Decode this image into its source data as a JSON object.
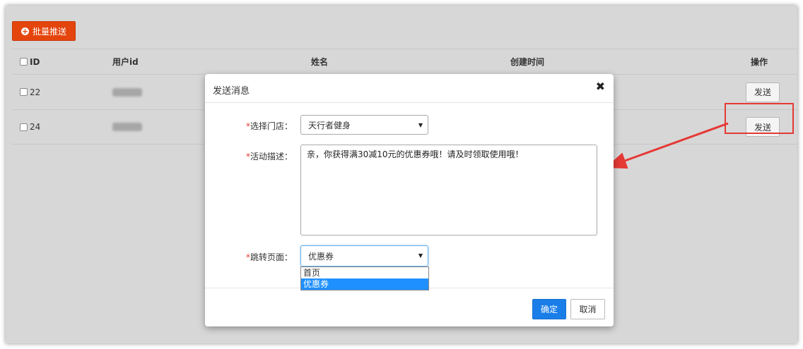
{
  "toolbar": {
    "batch_push_label": "批量推送",
    "batch_push_icon": "plus-circle-icon"
  },
  "table": {
    "headers": {
      "id": "ID",
      "user_id": "用户id",
      "name": "姓名",
      "created": "创建时间",
      "ops": "操作"
    },
    "rows": [
      {
        "id": "22",
        "send_label": "发送"
      },
      {
        "id": "24",
        "send_label": "发送"
      }
    ]
  },
  "modal": {
    "title": "发送消息",
    "close_icon": "close-icon",
    "store_label": "选择门店：",
    "store_value": "天行者健身",
    "desc_label": "活动描述：",
    "desc_value": "亲，你获得满30减10元的优惠券哦！请及时领取使用哦！",
    "page_label": "跳转页面：",
    "page_value": "优惠券",
    "page_options": [
      "首页",
      "优惠券"
    ],
    "required_mark": "*",
    "ok_label": "确定",
    "cancel_label": "取消"
  },
  "colors": {
    "accent": "#e4450d",
    "primary": "#1a7ee8",
    "highlight": "#e53935"
  }
}
